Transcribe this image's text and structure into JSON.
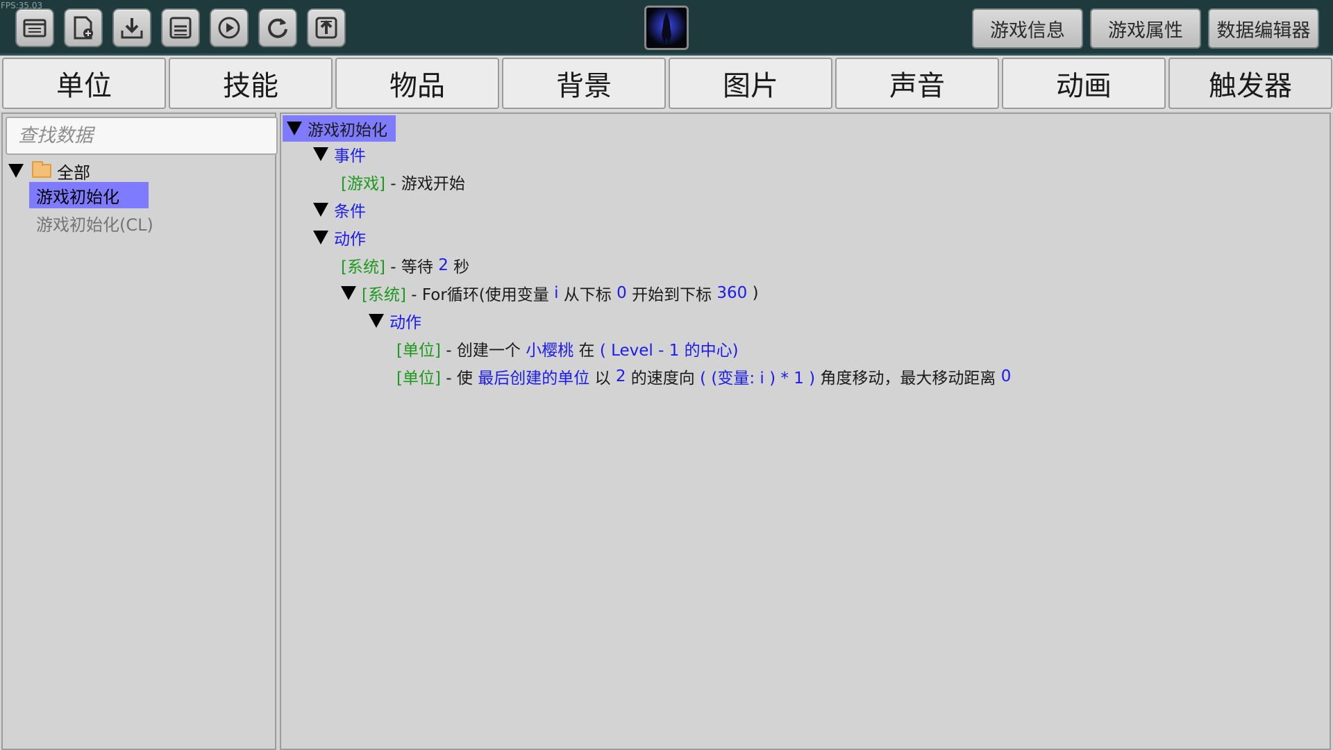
{
  "fps": "FPS:35.03",
  "toolbar": {
    "icons": [
      "open-folder-icon",
      "new-file-icon",
      "download-icon",
      "save-icon",
      "play-icon",
      "refresh-icon",
      "upload-icon"
    ],
    "right_buttons": [
      "游戏信息",
      "游戏属性",
      "数据编辑器"
    ]
  },
  "tabs": [
    "单位",
    "技能",
    "物品",
    "背景",
    "图片",
    "声音",
    "动画",
    "触发器"
  ],
  "search": {
    "placeholder": "查找数据"
  },
  "tree": {
    "root": "全部",
    "items": [
      "游戏初始化",
      "游戏初始化(CL)"
    ]
  },
  "trigger": {
    "title": "游戏初始化",
    "events_label": "事件",
    "event1": {
      "tag": "[游戏]",
      "text": " - 游戏开始"
    },
    "conditions_label": "条件",
    "actions_label": "动作",
    "action_wait": {
      "tag": "[系统]",
      "pre": " - 等待 ",
      "num": "2",
      "post": " 秒"
    },
    "action_for": {
      "tag": "[系统]",
      "pre": " - For循环(使用变量 ",
      "var": "i",
      "mid": " 从下标 ",
      "start": "0",
      "mid2": " 开始到下标 ",
      "end": "360",
      "post": " )"
    },
    "inner_actions_label": "动作",
    "action_create": {
      "tag": "[单位]",
      "pre": " - 创建一个 ",
      "unit": "小樱桃",
      "mid": " 在 ",
      "loc": "( Level - 1 的中心)"
    },
    "action_move": {
      "tag": "[单位]",
      "pre": " - 使 ",
      "unit": "最后创建的单位",
      "mid": " 以 ",
      "speed": "2",
      "mid2": " 的速度向 ",
      "angle": "( (变量: i ) * 1 )",
      "mid3": " 角度移动，最大移动距离 ",
      "dist": "0"
    }
  }
}
